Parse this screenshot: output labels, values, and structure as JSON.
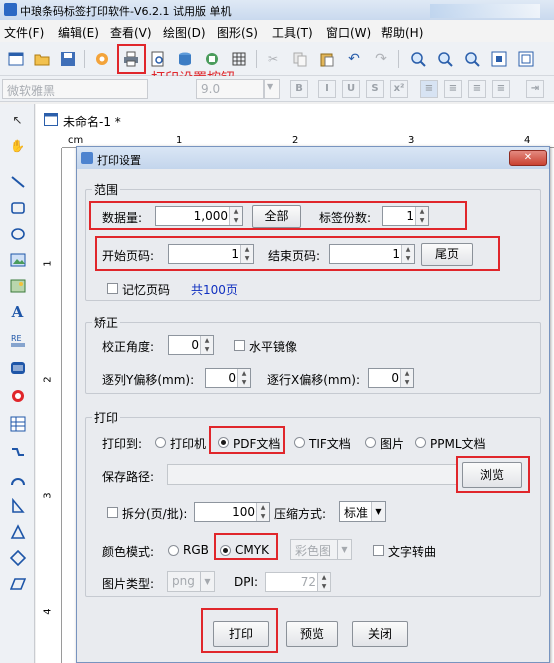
{
  "app": {
    "title": "中琅条码标签打印软件-V6.2.1 试用版 单机"
  },
  "menu": [
    "文件(F)",
    "编辑(E)",
    "查看(V)",
    "绘图(D)",
    "图形(S)",
    "工具(T)",
    "窗口(W)",
    "帮助(H)"
  ],
  "annotation": {
    "callout": "打印设置按钮",
    "color": "#e0262b"
  },
  "fontbar": {
    "font_name": "微软雅黑",
    "font_size": "9.0",
    "buttons": [
      "B",
      "I",
      "U",
      "S"
    ]
  },
  "document": {
    "tab_title": "未命名-1 *",
    "ruler_unit": "cm",
    "h_ruler": [
      "1",
      "2",
      "3",
      "4"
    ],
    "v_ruler": [
      "1",
      "2",
      "3",
      "4"
    ]
  },
  "dialog": {
    "title": "打印设置",
    "range": {
      "legend": "范围",
      "data_qty_label": "数据量:",
      "data_qty_value": "1,000",
      "all_button": "全部",
      "label_copies_label": "标签份数:",
      "label_copies_value": "1",
      "start_page_label": "开始页码:",
      "start_page_value": "1",
      "end_page_label": "结束页码:",
      "end_page_value": "1",
      "last_page_button": "尾页",
      "remember_page_label": "记忆页码",
      "total_pages": "共100页"
    },
    "correction": {
      "legend": "矫正",
      "angle_label": "校正角度:",
      "angle_value": "0",
      "mirror_label": "水平镜像",
      "y_offset_label": "逐列Y偏移(mm):",
      "y_offset_value": "0",
      "x_offset_label": "逐行X偏移(mm):",
      "x_offset_value": "0"
    },
    "print": {
      "legend": "打印",
      "print_to_label": "打印到:",
      "targets": [
        "打印机",
        "PDF文档",
        "TIF文档",
        "图片",
        "PPML文档"
      ],
      "selected_target": "PDF文档",
      "save_path_label": "保存路径:",
      "save_path_value": "",
      "browse_button": "浏览",
      "split_label": "拆分(页/批):",
      "split_value": "100",
      "compress_label": "压缩方式:",
      "compress_value": "标准",
      "color_mode_label": "颜色模式:",
      "color_modes": [
        "RGB",
        "CMYK"
      ],
      "selected_color_mode": "CMYK",
      "color_combo_value": "彩色图",
      "text_to_curve_label": "文字转曲",
      "image_type_label": "图片类型:",
      "image_type_value": "png",
      "dpi_label": "DPI:",
      "dpi_value": "72"
    },
    "buttons": {
      "print": "打印",
      "preview": "预览",
      "close": "关闭"
    }
  }
}
